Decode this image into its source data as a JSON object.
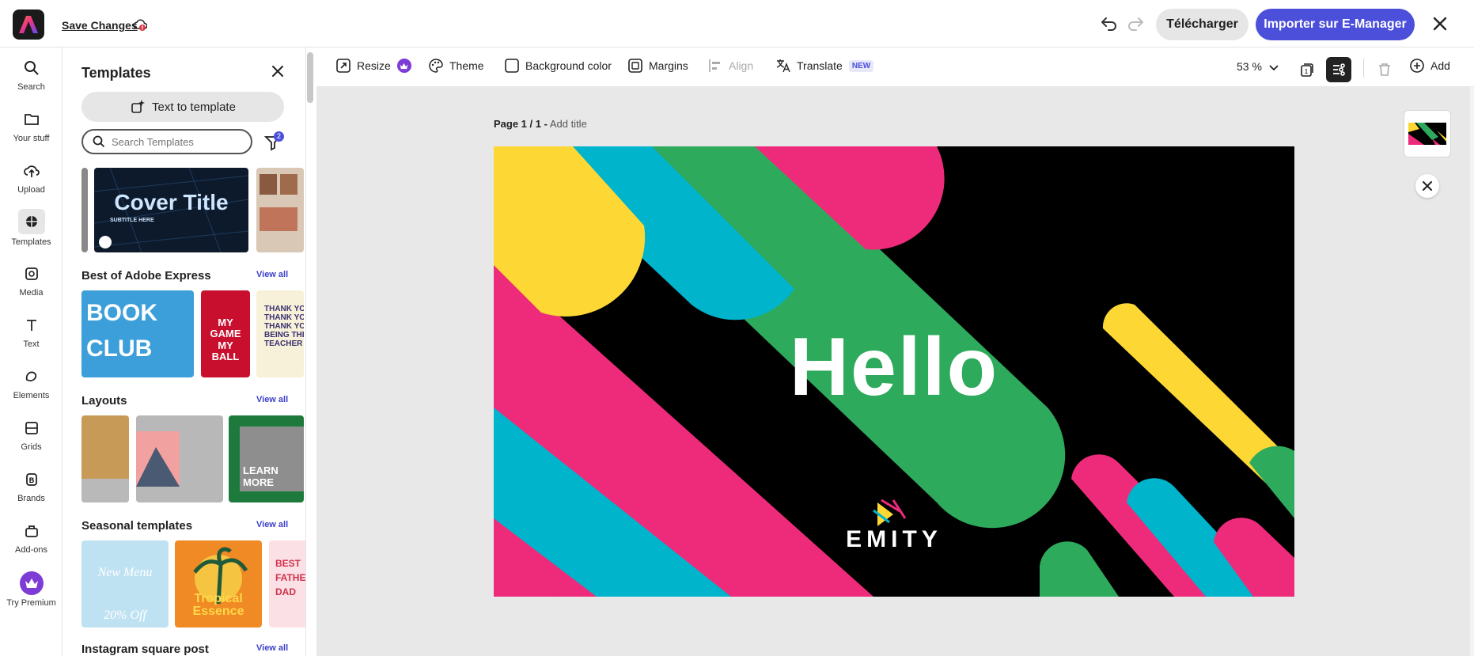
{
  "topbar": {
    "save_label": "Save Changes",
    "download_label": "Télécharger",
    "import_label": "Importer sur E-Manager"
  },
  "rail": [
    {
      "label": "Search",
      "icon": "search-icon"
    },
    {
      "label": "Your stuff",
      "icon": "folder-icon"
    },
    {
      "label": "Upload",
      "icon": "upload-icon"
    },
    {
      "label": "Templates",
      "icon": "templates-icon"
    },
    {
      "label": "Media",
      "icon": "media-icon"
    },
    {
      "label": "Text",
      "icon": "text-icon"
    },
    {
      "label": "Elements",
      "icon": "elements-icon"
    },
    {
      "label": "Grids",
      "icon": "grids-icon"
    },
    {
      "label": "Brands",
      "icon": "brands-icon"
    },
    {
      "label": "Add-ons",
      "icon": "addons-icon"
    },
    {
      "label": "Try Premium",
      "icon": "crown-icon"
    }
  ],
  "panel": {
    "title": "Templates",
    "text_to_template": "Text to template",
    "search_placeholder": "Search Templates",
    "filter_count": "2",
    "cover_title": "Cover Title",
    "cover_subtitle": "SUBTITLE HERE",
    "sections": [
      {
        "title": "Best of Adobe Express",
        "view_all": "View all"
      },
      {
        "title": "Layouts",
        "view_all": "View all"
      },
      {
        "title": "Seasonal templates",
        "view_all": "View all"
      },
      {
        "title": "Instagram square post",
        "view_all": "View all"
      }
    ],
    "best_thumbs": [
      "BOOK CLUB",
      "MY GAME MY BALL",
      "THANK YOU THANK YOU THANK YOU FOR BEING THE BEST TEACHER"
    ],
    "layout_thumbs": [
      "",
      "",
      "LEARN MORE"
    ],
    "seasonal_thumbs": [
      "New Menu 20% Off",
      "Tropical Essence",
      "BEST FATHER DAD"
    ]
  },
  "toolbar": {
    "resize": "Resize",
    "theme": "Theme",
    "background_color": "Background color",
    "margins": "Margins",
    "align": "Align",
    "translate": "Translate",
    "new_badge": "NEW",
    "zoom": "53 %",
    "add": "Add"
  },
  "canvas": {
    "page_label": "Page 1 / 1 -",
    "add_title": "Add title",
    "hello": "Hello",
    "brand": "EMITY"
  },
  "colors": {
    "accent": "#4b4fd9",
    "yellow": "#fdd835",
    "teal": "#00b4cc",
    "green": "#2eaa5c",
    "pink": "#ee2a7b"
  }
}
